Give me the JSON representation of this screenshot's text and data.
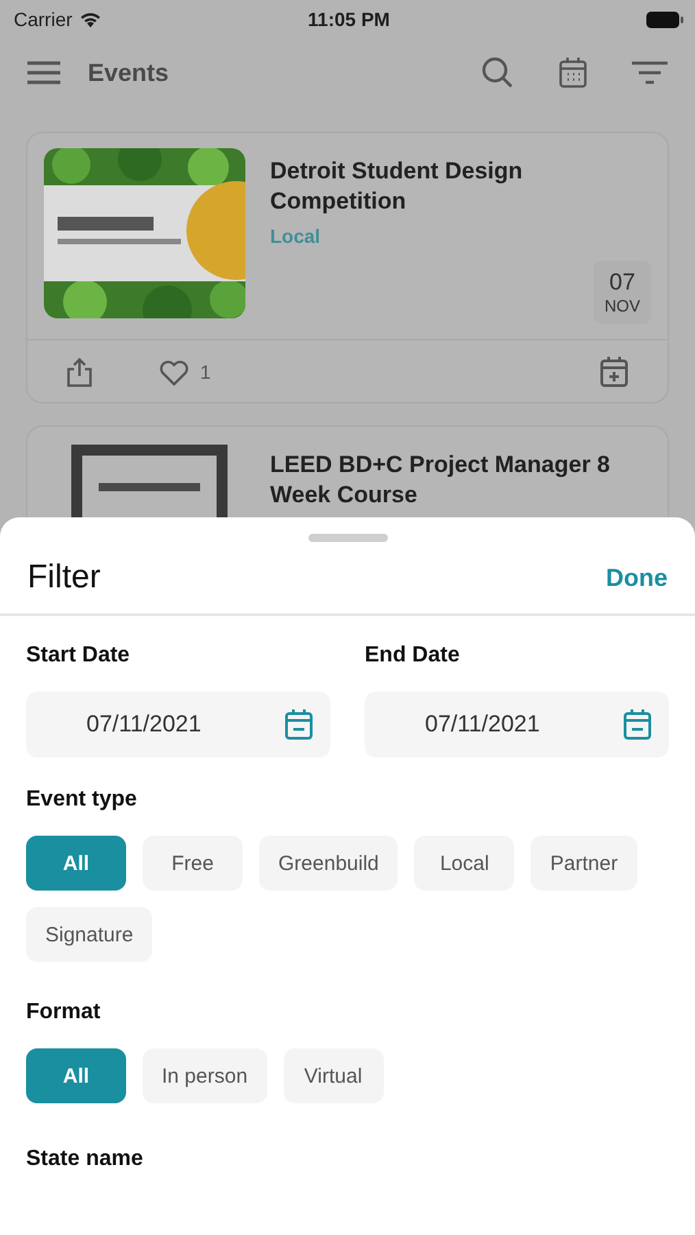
{
  "status_bar": {
    "carrier": "Carrier",
    "time": "11:05 PM"
  },
  "nav": {
    "title": "Events"
  },
  "events": [
    {
      "title": "Detroit Student Design Competition",
      "type": "Local",
      "day": "07",
      "month": "NOV",
      "likes": "1"
    },
    {
      "title": "LEED BD+C Project Manager 8 Week Course"
    }
  ],
  "filter": {
    "title": "Filter",
    "done": "Done",
    "dates": [
      {
        "label": "Start Date",
        "value": "07/11/2021"
      },
      {
        "label": "End Date",
        "value": "07/11/2021"
      }
    ],
    "groups": [
      {
        "label": "Event type",
        "options": [
          {
            "label": "All",
            "selected": true
          },
          {
            "label": "Free",
            "selected": false
          },
          {
            "label": "Greenbuild",
            "selected": false
          },
          {
            "label": "Local",
            "selected": false
          },
          {
            "label": "Partner",
            "selected": false
          },
          {
            "label": "Signature",
            "selected": false
          }
        ]
      },
      {
        "label": "Format",
        "options": [
          {
            "label": "All",
            "selected": true
          },
          {
            "label": "In person",
            "selected": false
          },
          {
            "label": "Virtual",
            "selected": false
          }
        ]
      }
    ],
    "state_name": {
      "label": "State name"
    }
  }
}
